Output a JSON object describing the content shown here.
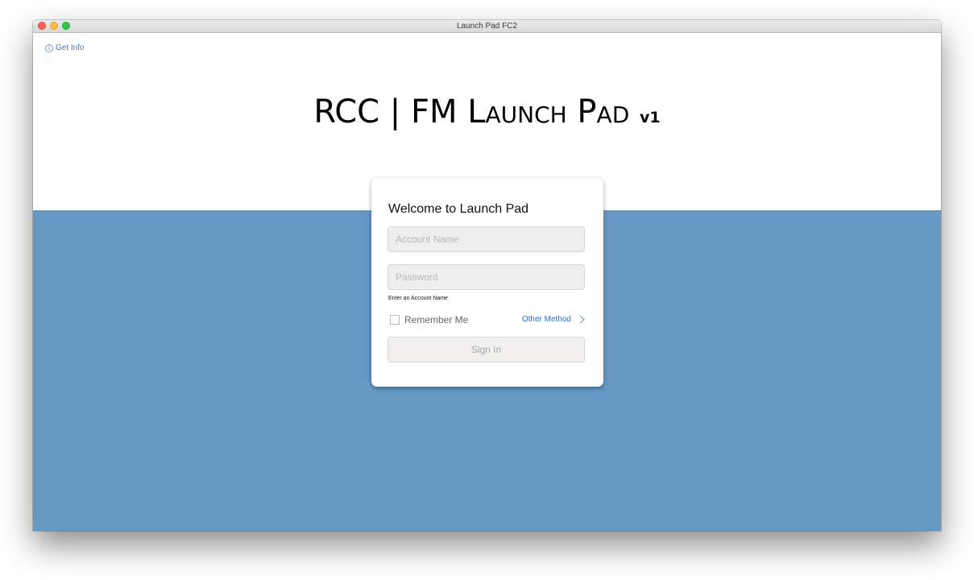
{
  "window": {
    "title": "Launch Pad FC2"
  },
  "header": {
    "get_info": "Get Info",
    "info_icon": "i",
    "title_main": "RCC | FM ",
    "title_small_caps": "Launch Pad",
    "title_version": "v1"
  },
  "login": {
    "heading": "Welcome to Launch Pad",
    "account_placeholder": "Account Name",
    "account_value": "",
    "password_placeholder": "Password",
    "password_value": "",
    "helper_text": "Enter an Account Name",
    "remember_label": "Remember Me",
    "remember_checked": false,
    "other_method": "Other Method",
    "signin_label": "Sign In"
  },
  "colors": {
    "background_blue": "#6698c4",
    "link_blue": "#2f6fc0"
  },
  "icons": {
    "info": "info-icon",
    "chevron": "chevron-right-icon"
  }
}
